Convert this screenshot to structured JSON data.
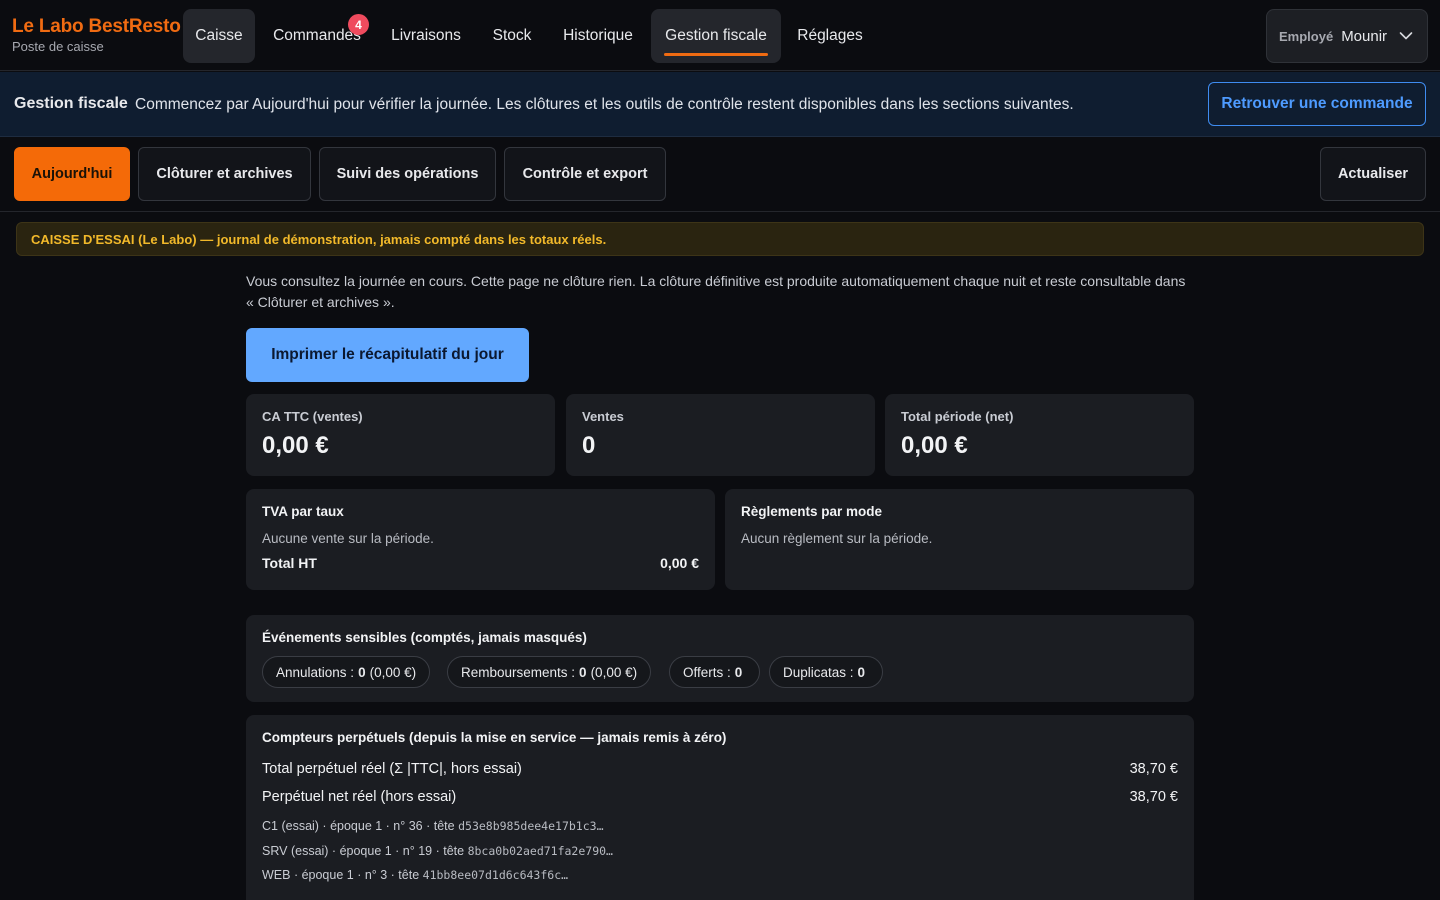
{
  "brand": {
    "name": "Le Labo BestResto",
    "subtitle": "Poste de caisse"
  },
  "nav": {
    "tabs": [
      {
        "label": "Caisse"
      },
      {
        "label": "Commandes",
        "badge": "4"
      },
      {
        "label": "Livraisons"
      },
      {
        "label": "Stock"
      },
      {
        "label": "Historique"
      },
      {
        "label": "Gestion fiscale"
      },
      {
        "label": "Réglages"
      }
    ],
    "active": "Gestion fiscale"
  },
  "employee": {
    "label": "Employé",
    "name": "Mounir"
  },
  "banner": {
    "title": "Gestion fiscale",
    "text": "Commencez par Aujourd'hui pour vérifier la journée. Les clôtures et les outils de contrôle restent disponibles dans les sections suivantes.",
    "button": "Retrouver une commande"
  },
  "subtabs": {
    "items": [
      "Aujourd'hui",
      "Clôturer et archives",
      "Suivi des opérations",
      "Contrôle et export"
    ],
    "refresh": "Actualiser"
  },
  "warning": "CAISSE D'ESSAI (Le Labo) — journal de démonstration, jamais compté dans les totaux réels.",
  "intro": "Vous consultez la journée en cours. Cette page ne clôture rien. La clôture définitive est produite automatiquement chaque nuit et reste consultable dans « Clôturer et archives ».",
  "print_button": "Imprimer le récapitulatif du jour",
  "kpis": [
    {
      "label": "CA TTC (ventes)",
      "value": "0,00 €"
    },
    {
      "label": "Ventes",
      "value": "0"
    },
    {
      "label": "Total période (net)",
      "value": "0,00 €"
    }
  ],
  "vat": {
    "title": "TVA par taux",
    "empty": "Aucune vente sur la période.",
    "total_label": "Total HT",
    "total_value": "0,00 €"
  },
  "payments": {
    "title": "Règlements par mode",
    "empty": "Aucun règlement sur la période."
  },
  "events": {
    "title": "Événements sensibles (comptés, jamais masqués)",
    "pills": [
      {
        "label": "Annulations :",
        "count": "0",
        "amount": "(0,00 €)"
      },
      {
        "label": "Remboursements :",
        "count": "0",
        "amount": "(0,00 €)"
      },
      {
        "label": "Offerts :",
        "count": "0",
        "amount": ""
      },
      {
        "label": "Duplicatas :",
        "count": "0",
        "amount": ""
      }
    ]
  },
  "counters": {
    "title": "Compteurs perpétuels (depuis la mise en service — jamais remis à zéro)",
    "rows": [
      {
        "label": "Total perpétuel réel (Σ |TTC|, hors essai)",
        "value": "38,70 €"
      },
      {
        "label": "Perpétuel net réel (hors essai)",
        "value": "38,70 €"
      }
    ],
    "chains": [
      {
        "text": "C1 (essai) · époque 1 · n° 36 · tête",
        "hash": "d53e8b985dee4e17b1c3…"
      },
      {
        "text": "SRV (essai) · époque 1 · n° 19 · tête",
        "hash": "8bca0b02aed71fa2e790…"
      },
      {
        "text": "WEB · époque 1 · n° 3 · tête",
        "hash": "41bb8ee07d1d6c643f6c…"
      }
    ]
  },
  "colors": {
    "accent": "#f06b12",
    "primary_blue": "#62a8ff",
    "badge_red": "#ef4b5e",
    "warning": "#f2b92a"
  }
}
